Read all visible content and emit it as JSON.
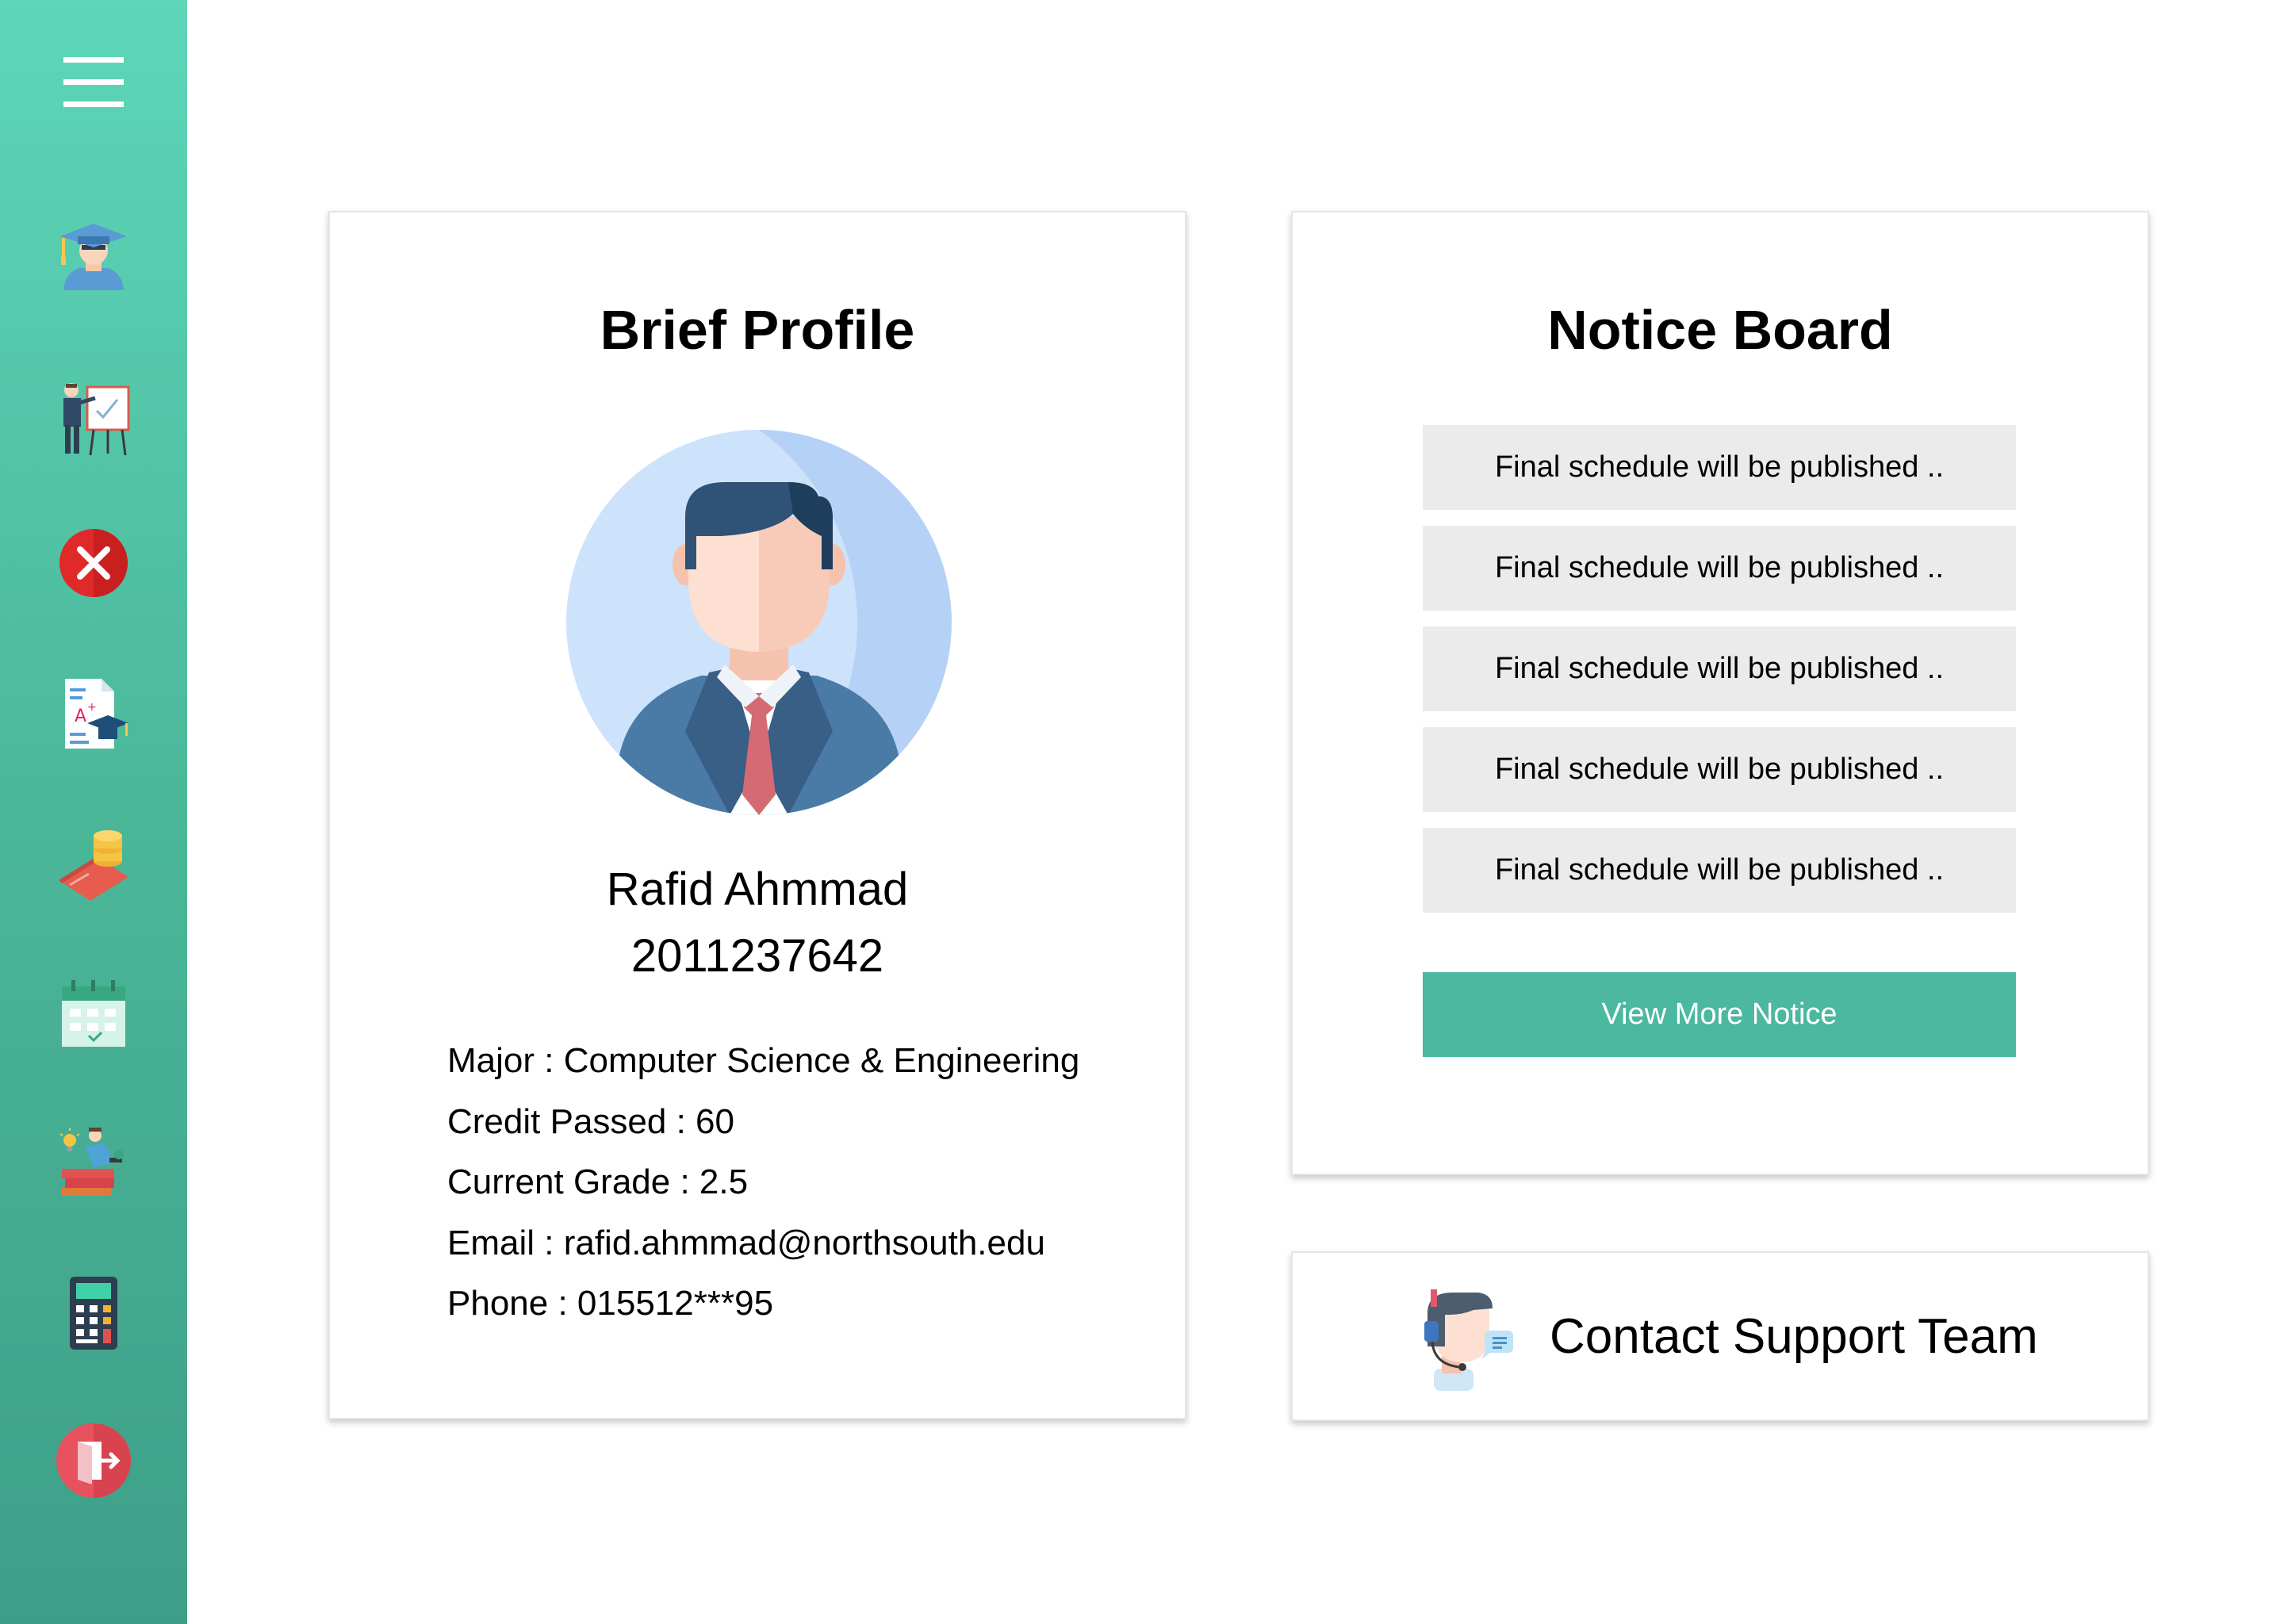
{
  "sidebar": {
    "items": [
      {
        "icon": "menu-icon"
      },
      {
        "icon": "student-graduate-icon"
      },
      {
        "icon": "presentation-teacher-icon"
      },
      {
        "icon": "close-circle-icon"
      },
      {
        "icon": "grade-report-icon"
      },
      {
        "icon": "payment-coins-icon"
      },
      {
        "icon": "calendar-icon"
      },
      {
        "icon": "study-books-icon"
      },
      {
        "icon": "calculator-icon"
      },
      {
        "icon": "logout-door-icon"
      }
    ]
  },
  "profile": {
    "title": "Brief Profile",
    "name": "Rafid Ahmmad",
    "id": "2011237642",
    "details": [
      "Major : Computer Science & Engineering",
      "Credit Passed : 60",
      "Current Grade : 2.5",
      "Email : rafid.ahmmad@northsouth.edu",
      "Phone : 015512***95"
    ]
  },
  "notice": {
    "title": "Notice Board",
    "items": [
      "Final schedule will be published ..",
      "Final schedule will be published ..",
      "Final schedule will be published ..",
      "Final schedule will be published ..",
      "Final schedule will be published .."
    ],
    "button_label": "View More Notice"
  },
  "support": {
    "label": "Contact Support Team"
  },
  "colors": {
    "accent": "#4bb89f",
    "sidebar_top": "#5dd6b9",
    "sidebar_bottom": "#3e9f88",
    "notice_bg": "#ebebeb"
  }
}
